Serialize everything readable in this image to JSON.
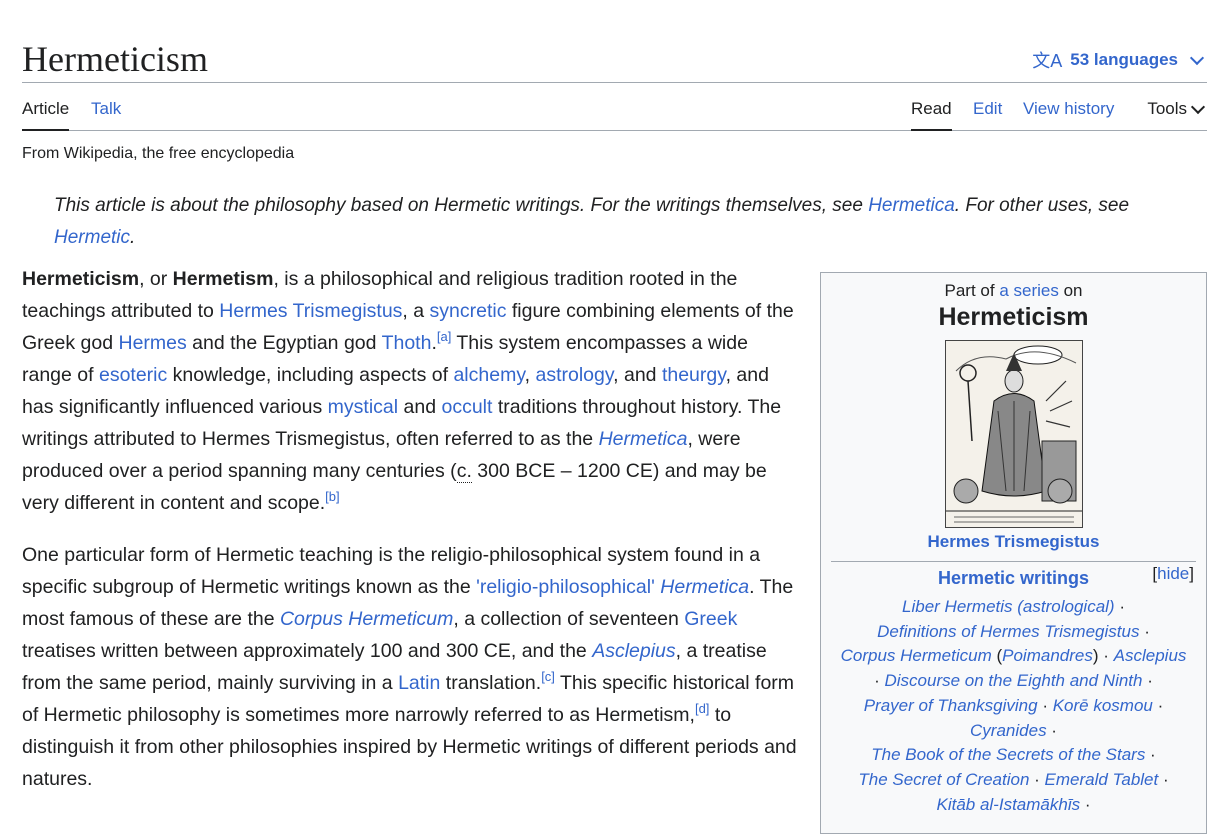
{
  "page": {
    "title": "Hermeticism",
    "languages": "53 languages",
    "tabs": {
      "article": "Article",
      "talk": "Talk",
      "read": "Read",
      "edit": "Edit",
      "history": "View history",
      "tools": "Tools"
    },
    "from": "From Wikipedia, the free encyclopedia"
  },
  "hatnote": {
    "t1": "This article is about the philosophy based on Hermetic writings. For the writings themselves, see ",
    "l1": "Hermetica",
    "t2": ". For other uses, see ",
    "l2": "Hermetic",
    "t3": "."
  },
  "p1": {
    "b1": "Hermeticism",
    "t1": ", or ",
    "b2": "Hermetism",
    "t2": ", is a philosophical and religious tradition rooted in the teachings attributed to ",
    "l1": "Hermes Trismegistus",
    "t3": ", a ",
    "l2": "syncretic",
    "t4": " figure combining elements of the Greek god ",
    "l3": "Hermes",
    "t5": " and the Egyptian god ",
    "l4": "Thoth",
    "t6": ".",
    "s1": "[a]",
    "t7": " This system encompasses a wide range of ",
    "l5": "esoteric",
    "t8": " knowledge, including aspects of ",
    "l6": "alchemy",
    "t9": ", ",
    "l7": "astrology",
    "t10": ", and ",
    "l8": "theurgy",
    "t11": ", and has significantly influenced various ",
    "l9": "mystical",
    "t12": " and ",
    "l10": "occult",
    "t13": " traditions throughout history. The writings attributed to Hermes Trismegistus, often referred to as the ",
    "l11": "Hermetica",
    "t14": ", were produced over a period spanning many centuries (",
    "a1": "c.",
    "t15": " 300 BCE – 1200 CE) and may be very different in content and scope.",
    "s2": "[b]"
  },
  "p2": {
    "t1": "One particular form of Hermetic teaching is the religio-philosophical system found in a specific subgroup of Hermetic writings known as the ",
    "l1": "'religio-philosophical' ",
    "l1i": "Hermetica",
    "t2": ". The most famous of these are the ",
    "l2": "Corpus Hermeticum",
    "t3": ", a collection of seventeen ",
    "l3": "Greek",
    "t4": " treatises written between approximately 100 and 300 CE, and the ",
    "l4": "Asclepius",
    "t5": ", a treatise from the same period, mainly surviving in a ",
    "l5": "Latin",
    "t6": " translation.",
    "s1": "[c]",
    "t7": " This specific historical form of Hermetic philosophy is sometimes more narrowly referred to as Hermetism,",
    "s2": "[d]",
    "t8": " to distinguish it from other philosophies inspired by Hermetic writings of different periods and natures."
  },
  "infobox": {
    "part_pre": "Part of ",
    "part_link": "a series",
    "part_post": " on",
    "title": "Hermeticism",
    "caption": "Hermes Trismegistus",
    "section": "Hermetic writings",
    "hide": "hide",
    "items": {
      "i1": "Liber Hermetis (astrological)",
      "i2": "Definitions of Hermes Trismegistus",
      "i3": "Corpus Hermeticum",
      "i3b": "Poimandres",
      "i4": "Asclepius",
      "i5": "Discourse on the Eighth and Ninth",
      "i6": "Prayer of Thanksgiving",
      "i7": "Korē kosmou",
      "i8": "Cyranides",
      "i9": "The Book of the Secrets of the Stars",
      "i10": "The Secret of Creation",
      "i11": "Emerald Tablet",
      "i12": "Kitāb al-Istamākhīs"
    }
  }
}
